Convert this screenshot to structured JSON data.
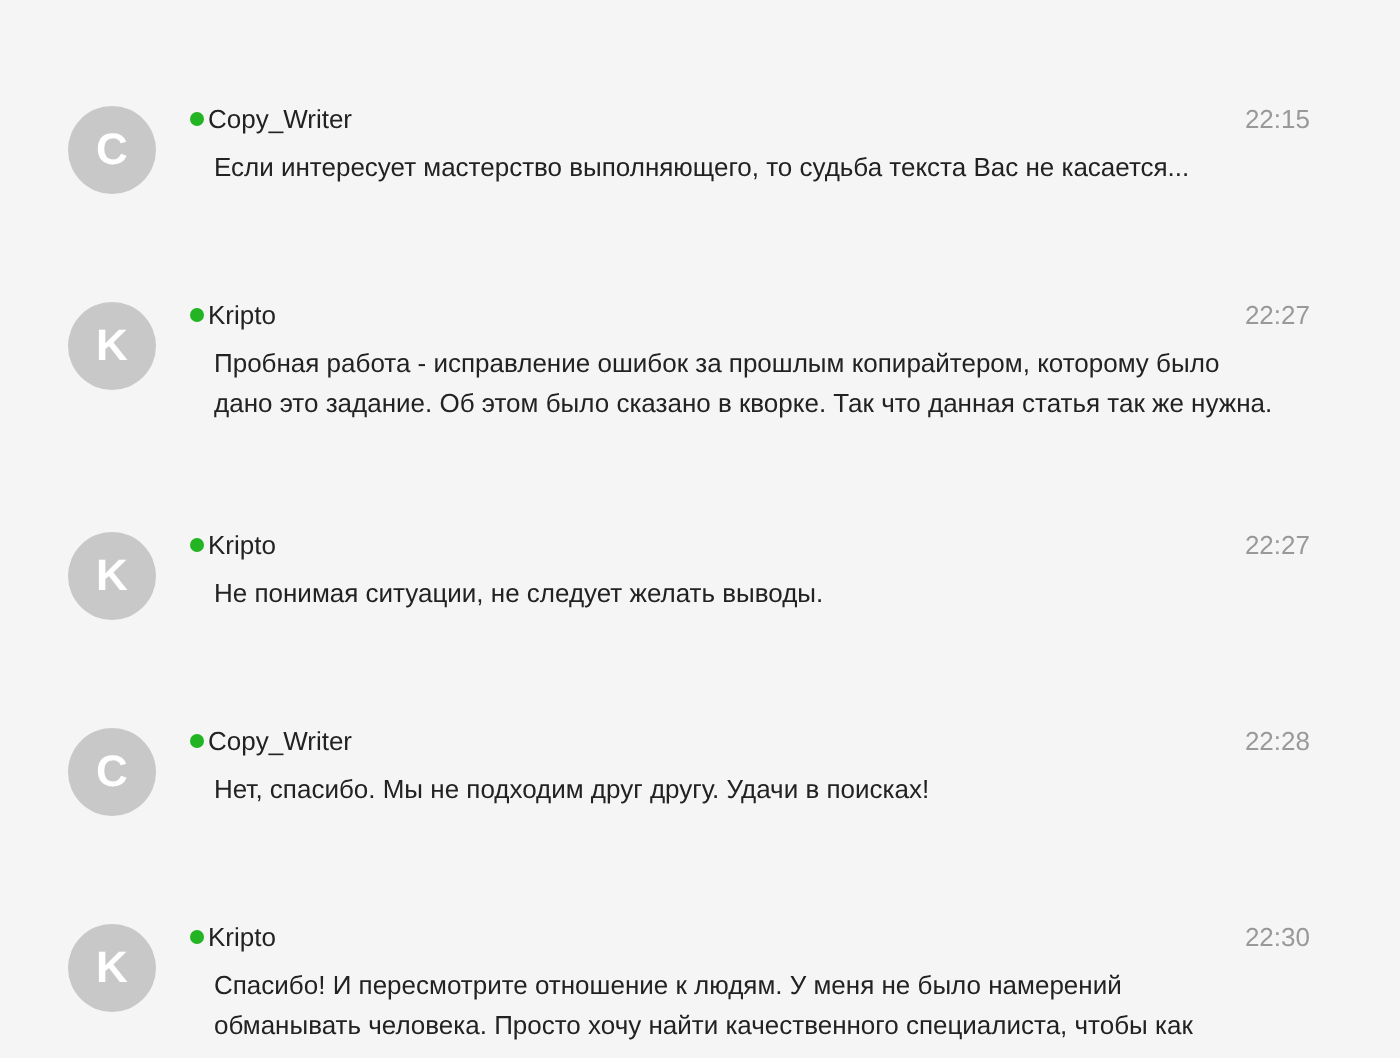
{
  "messages": [
    {
      "avatar": "C",
      "author": "Copy_Writer",
      "online": true,
      "time": "22:15",
      "lines": [
        "Если интересует мастерство выполняющего, то судьба текста Вас не касается..."
      ]
    },
    {
      "avatar": "K",
      "author": "Kripto",
      "online": true,
      "time": "22:27",
      "lines": [
        "Пробная работа - исправление ошибок за прошлым копирайтером, которому было",
        "дано это задание. Об этом было сказано в кворке. Так что данная статья так же нужна."
      ]
    },
    {
      "avatar": "K",
      "author": "Kripto",
      "online": true,
      "time": "22:27",
      "lines": [
        "Не понимая ситуации, не следует желать выводы."
      ]
    },
    {
      "avatar": "C",
      "author": "Copy_Writer",
      "online": true,
      "time": "22:28",
      "lines": [
        "Нет, спасибо. Мы не подходим друг другу. Удачи в поисках!"
      ]
    },
    {
      "avatar": "K",
      "author": "Kripto",
      "online": true,
      "time": "22:30",
      "lines": [
        "Спасибо! И пересмотрите отношение к людям. У меня не было намерений",
        "обманывать человека. Просто хочу найти качественного специалиста, чтобы как"
      ]
    }
  ]
}
